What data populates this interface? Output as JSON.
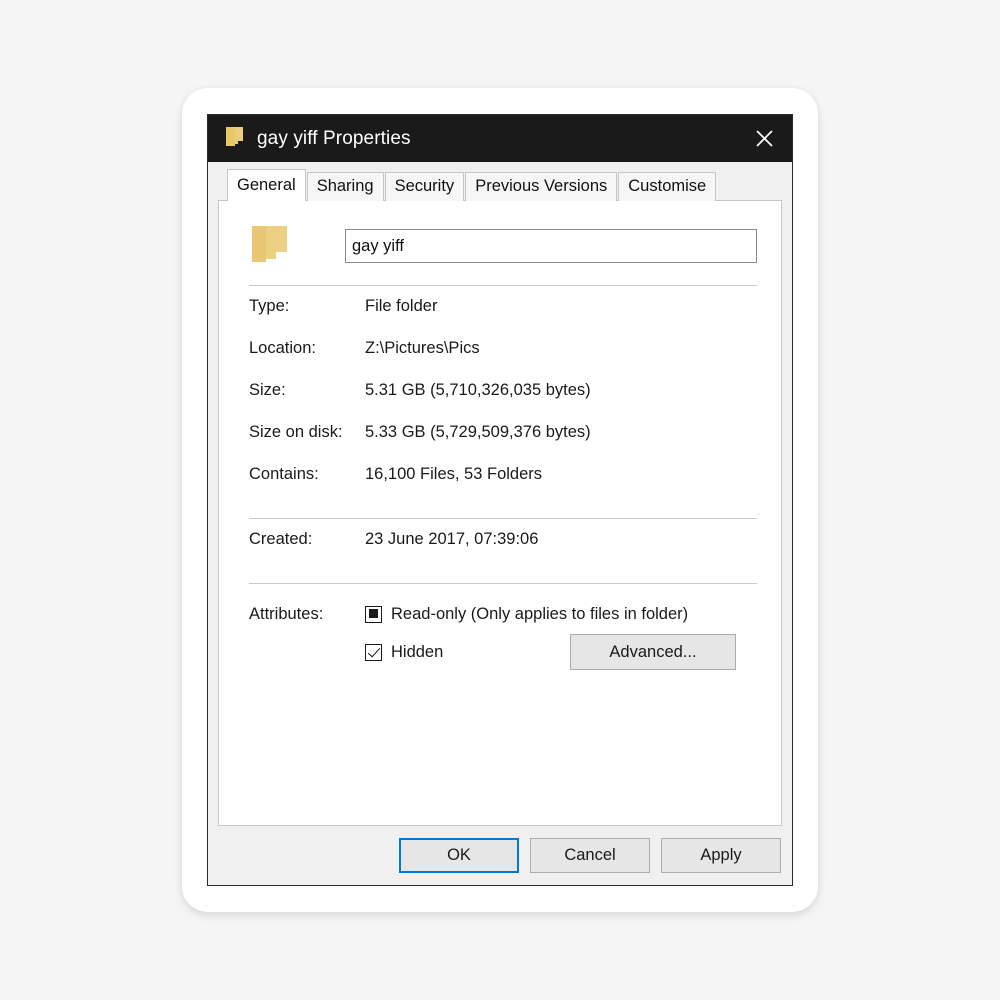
{
  "window": {
    "title": "gay yiff Properties",
    "title_icon": "folder-icon",
    "close_icon": "close-icon"
  },
  "tabs": [
    {
      "label": "General",
      "selected": true
    },
    {
      "label": "Sharing",
      "selected": false
    },
    {
      "label": "Security",
      "selected": false
    },
    {
      "label": "Previous Versions",
      "selected": false
    },
    {
      "label": "Customise",
      "selected": false
    }
  ],
  "general": {
    "folder_icon": "folder-icon",
    "name_value": "gay yiff",
    "name_placeholder": "",
    "rows": [
      {
        "label": "Type:",
        "value": "File folder"
      },
      {
        "label": "Location:",
        "value": "Z:\\Pictures\\Pics"
      },
      {
        "label": "Size:",
        "value": "5.31 GB (5,710,326,035 bytes)"
      },
      {
        "label": "Size on disk:",
        "value": "5.33 GB (5,729,509,376 bytes)"
      },
      {
        "label": "Contains:",
        "value": "16,100 Files, 53 Folders"
      }
    ],
    "created": {
      "label": "Created:",
      "value": "23 June 2017, 07:39:06"
    },
    "attributes": {
      "label": "Attributes:",
      "readonly": {
        "text": "Read-only (Only applies to files in folder)",
        "state": "indeterminate"
      },
      "hidden": {
        "text": "Hidden",
        "state": "checked"
      },
      "advanced_label": "Advanced..."
    }
  },
  "buttons": {
    "ok": "OK",
    "cancel": "Cancel",
    "apply": "Apply"
  },
  "colors": {
    "accent": "#0078d7",
    "titlebar": "#1a1a1a",
    "dialog_face": "#f0f0f0",
    "panel": "#ffffff",
    "folder_yellow": "#f0ce7a",
    "page_background": "#f5f5f5"
  }
}
